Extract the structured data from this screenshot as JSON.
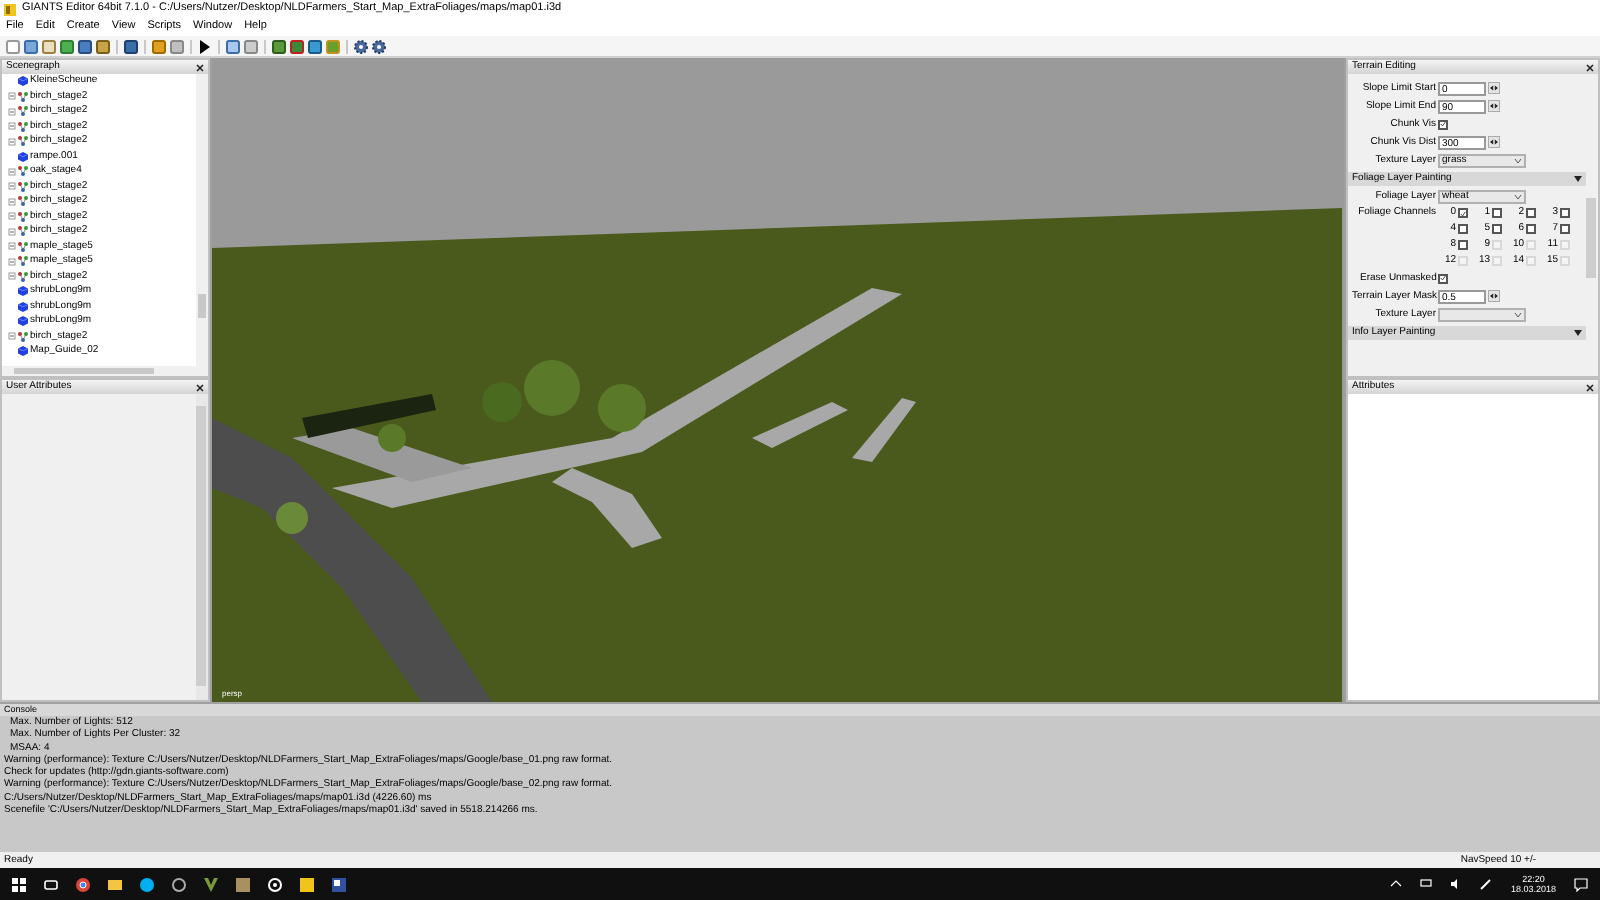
{
  "window": {
    "title": "GIANTS Editor 64bit 7.1.0 - C:/Users/Nutzer/Desktop/NLDFarmers_Start_Map_ExtraFoliages/maps/map01.i3d"
  },
  "menu": [
    "File",
    "Edit",
    "Create",
    "View",
    "Scripts",
    "Window",
    "Help"
  ],
  "scenegraph": {
    "title": "Scenegraph",
    "items": [
      {
        "label": "KleineScheune",
        "kind": "shape"
      },
      {
        "label": "birch_stage2",
        "kind": "transform"
      },
      {
        "label": "birch_stage2",
        "kind": "transform"
      },
      {
        "label": "birch_stage2",
        "kind": "transform"
      },
      {
        "label": "birch_stage2",
        "kind": "transform"
      },
      {
        "label": "rampe.001",
        "kind": "shape"
      },
      {
        "label": "oak_stage4",
        "kind": "transform"
      },
      {
        "label": "birch_stage2",
        "kind": "transform"
      },
      {
        "label": "birch_stage2",
        "kind": "transform"
      },
      {
        "label": "birch_stage2",
        "kind": "transform"
      },
      {
        "label": "birch_stage2",
        "kind": "transform"
      },
      {
        "label": "maple_stage5",
        "kind": "transform"
      },
      {
        "label": "maple_stage5",
        "kind": "transform"
      },
      {
        "label": "birch_stage2",
        "kind": "transform"
      },
      {
        "label": "shrubLong9m",
        "kind": "shape"
      },
      {
        "label": "shrubLong9m",
        "kind": "shape"
      },
      {
        "label": "shrubLong9m",
        "kind": "shape"
      },
      {
        "label": "birch_stage2",
        "kind": "transform"
      },
      {
        "label": "Map_Guide_02",
        "kind": "shape"
      }
    ]
  },
  "user_attributes": {
    "title": "User Attributes"
  },
  "viewport": {
    "camera_label": "persp"
  },
  "terrain_editing": {
    "title": "Terrain Editing",
    "slope_limit_start": {
      "label": "Slope Limit Start",
      "value": "0"
    },
    "slope_limit_end": {
      "label": "Slope Limit End",
      "value": "90"
    },
    "chunk_vis": {
      "label": "Chunk Vis",
      "checked": true
    },
    "chunk_vis_dist": {
      "label": "Chunk Vis Dist",
      "value": "300"
    },
    "texture_layer": {
      "label": "Texture Layer",
      "value": "grass"
    }
  },
  "foliage_layer_painting": {
    "title": "Foliage Layer Painting",
    "foliage_layer": {
      "label": "Foliage Layer",
      "value": "wheat"
    },
    "channels_label": "Foliage Channels",
    "channels": [
      {
        "label": "0",
        "checked": true,
        "disabled": false
      },
      {
        "label": "1",
        "checked": false,
        "disabled": false
      },
      {
        "label": "2",
        "checked": false,
        "disabled": false
      },
      {
        "label": "3",
        "checked": false,
        "disabled": false
      },
      {
        "label": "4",
        "checked": false,
        "disabled": false
      },
      {
        "label": "5",
        "checked": false,
        "disabled": false
      },
      {
        "label": "6",
        "checked": false,
        "disabled": false
      },
      {
        "label": "7",
        "checked": false,
        "disabled": false
      },
      {
        "label": "8",
        "checked": false,
        "disabled": false
      },
      {
        "label": "9",
        "checked": false,
        "disabled": true
      },
      {
        "label": "10",
        "checked": false,
        "disabled": true
      },
      {
        "label": "11",
        "checked": false,
        "disabled": true
      },
      {
        "label": "12",
        "checked": false,
        "disabled": true
      },
      {
        "label": "13",
        "checked": false,
        "disabled": true
      },
      {
        "label": "14",
        "checked": false,
        "disabled": true
      },
      {
        "label": "15",
        "checked": false,
        "disabled": true
      }
    ],
    "erase_unmasked": {
      "label": "Erase Unmasked",
      "checked": true
    },
    "terrain_layer_mask": {
      "label": "Terrain Layer Mask",
      "value": "0.5"
    },
    "texture_layer": {
      "label": "Texture Layer"
    }
  },
  "info_layer_painting": {
    "title": "Info Layer Painting"
  },
  "attributes": {
    "title": "Attributes"
  },
  "console": {
    "title": "Console",
    "lines": [
      "Max. Number of Lights: 512",
      "Max. Number of Lights Per Cluster: 32",
      "MSAA: 4",
      "Warning (performance): Texture C:/Users/Nutzer/Desktop/NLDFarmers_Start_Map_ExtraFoliages/maps/Google/base_01.png raw format.",
      "Check for updates (http://gdn.giants-software.com)",
      "Warning (performance): Texture C:/Users/Nutzer/Desktop/NLDFarmers_Start_Map_ExtraFoliages/maps/Google/base_02.png raw format.",
      "C:/Users/Nutzer/Desktop/NLDFarmers_Start_Map_ExtraFoliages/maps/map01.i3d (4226.60) ms",
      "Scenefile 'C:/Users/Nutzer/Desktop/NLDFarmers_Start_Map_ExtraFoliages/maps/map01.i3d' saved in 5518.214266 ms."
    ]
  },
  "status_bar": {
    "left": "Ready",
    "right": "NavSpeed 10 +/-"
  },
  "taskbar": {
    "time": "22:20",
    "date": "18.03.2018"
  }
}
